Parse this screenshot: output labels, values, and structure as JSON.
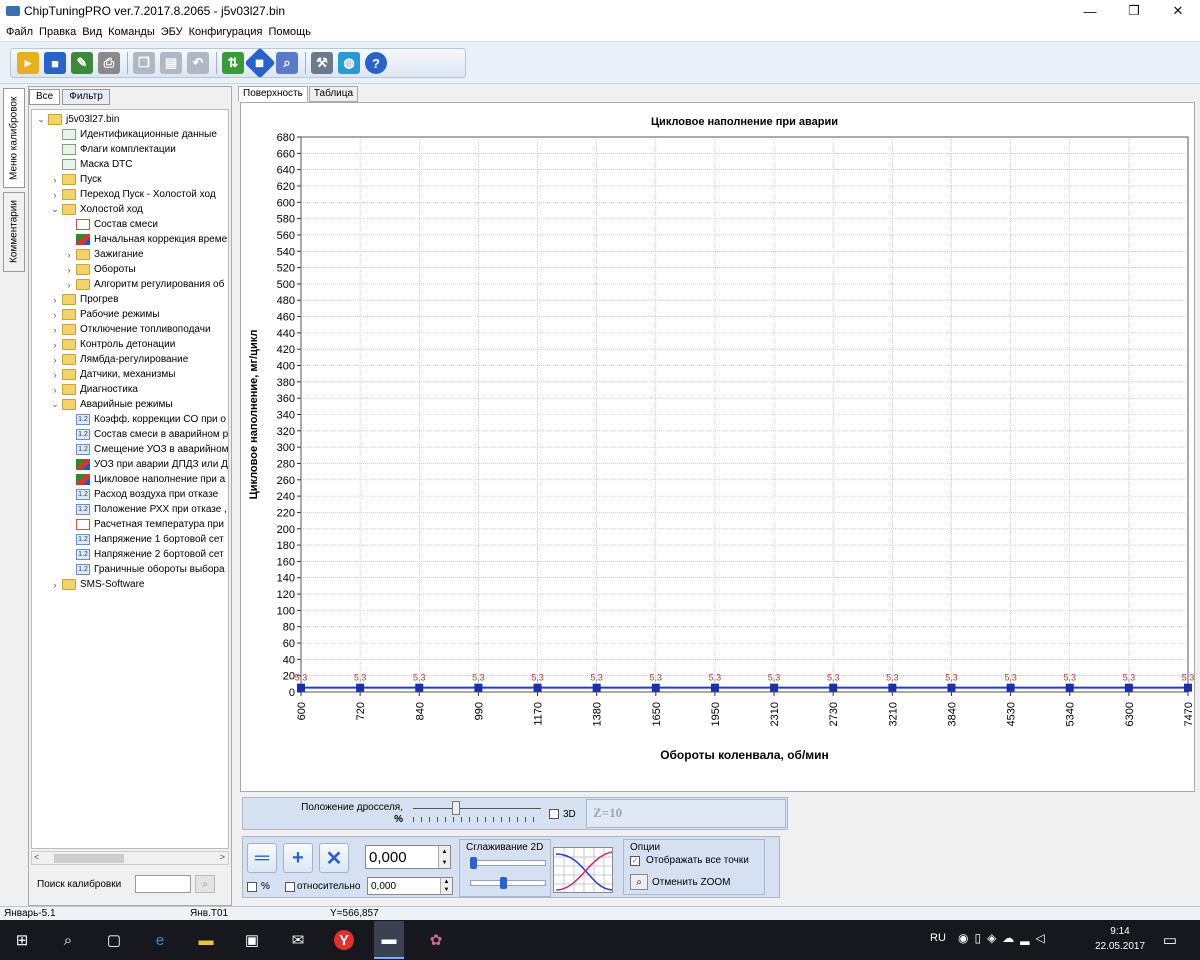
{
  "window": {
    "title": "ChipTuningPRO ver.7.2017.8.2065 - j5v03l27.bin"
  },
  "menu": [
    "Файл",
    "Правка",
    "Вид",
    "Команды",
    "ЭБУ",
    "Конфигурация",
    "Помощь"
  ],
  "side_tabs": {
    "calibration_menu": "Меню калибровок",
    "comments": "Комментарии"
  },
  "tree_tabs": {
    "all": "Все",
    "filter": "Фильтр"
  },
  "tree": [
    {
      "depth": 0,
      "icon": "folder",
      "expanded": true,
      "label": "j5v03l27.bin"
    },
    {
      "depth": 1,
      "icon": "check",
      "label": "Идентификационные данные"
    },
    {
      "depth": 1,
      "icon": "check",
      "label": "Флаги комплектации"
    },
    {
      "depth": 1,
      "icon": "check",
      "label": "Маска DTC"
    },
    {
      "depth": 1,
      "icon": "folder",
      "expanded": false,
      "label": "Пуск"
    },
    {
      "depth": 1,
      "icon": "folder",
      "expanded": false,
      "label": "Переход Пуск - Холостой ход"
    },
    {
      "depth": 1,
      "icon": "folder",
      "expanded": true,
      "label": "Холостой ход"
    },
    {
      "depth": 2,
      "icon": "graph",
      "label": "Состав смеси"
    },
    {
      "depth": 2,
      "icon": "chart3d",
      "label": "Начальная коррекция време"
    },
    {
      "depth": 2,
      "icon": "folder",
      "expanded": false,
      "label": "Зажигание"
    },
    {
      "depth": 2,
      "icon": "folder",
      "expanded": false,
      "label": "Обороты"
    },
    {
      "depth": 2,
      "icon": "folder",
      "expanded": false,
      "label": "Алгоритм регулирования об"
    },
    {
      "depth": 1,
      "icon": "folder",
      "expanded": false,
      "label": "Прогрев"
    },
    {
      "depth": 1,
      "icon": "folder",
      "expanded": false,
      "label": "Рабочие режимы"
    },
    {
      "depth": 1,
      "icon": "folder",
      "expanded": false,
      "label": "Отключение топливоподачи"
    },
    {
      "depth": 1,
      "icon": "folder",
      "expanded": false,
      "label": "Контроль детонации"
    },
    {
      "depth": 1,
      "icon": "folder",
      "expanded": false,
      "label": "Лямбда-регулирование"
    },
    {
      "depth": 1,
      "icon": "folder",
      "expanded": false,
      "label": "Датчики, механизмы"
    },
    {
      "depth": 1,
      "icon": "folder",
      "expanded": false,
      "label": "Диагностика"
    },
    {
      "depth": 1,
      "icon": "folder",
      "expanded": true,
      "label": "Аварийные режимы"
    },
    {
      "depth": 2,
      "icon": "n12",
      "label": "Коэфф. коррекции CO при о"
    },
    {
      "depth": 2,
      "icon": "n12",
      "label": "Состав смеси в аварийном р"
    },
    {
      "depth": 2,
      "icon": "n12",
      "label": "Смещение УОЗ в аварийном"
    },
    {
      "depth": 2,
      "icon": "chart3d",
      "label": "УОЗ при аварии ДПДЗ или Д"
    },
    {
      "depth": 2,
      "icon": "chart3d",
      "label": "Цикловое наполнение при а"
    },
    {
      "depth": 2,
      "icon": "n12",
      "label": "Расход воздуха при отказе"
    },
    {
      "depth": 2,
      "icon": "n12",
      "label": "Положение РХХ при отказе ,"
    },
    {
      "depth": 2,
      "icon": "graph",
      "label": "Расчетная температура при"
    },
    {
      "depth": 2,
      "icon": "n12",
      "label": "Напряжение 1 бортовой сет"
    },
    {
      "depth": 2,
      "icon": "n12",
      "label": "Напряжение 2 бортовой сет"
    },
    {
      "depth": 2,
      "icon": "n12",
      "label": "Граничные обороты выбора"
    },
    {
      "depth": 1,
      "icon": "folder",
      "expanded": false,
      "label": "SMS-Software"
    }
  ],
  "n12_glyph": "1.2",
  "search": {
    "label": "Поиск калибровки",
    "value": ""
  },
  "view_tabs": {
    "surface": "Поверхность",
    "table": "Таблица"
  },
  "chart_data": {
    "type": "line",
    "title": "Цикловое наполнение при аварии",
    "xlabel": "Обороты коленвала, об/мин",
    "ylabel": "Цикловое наполнение, мг/цикл",
    "ylim": [
      0,
      680
    ],
    "ytick_step": 20,
    "categories": [
      "600",
      "720",
      "840",
      "990",
      "1170",
      "1380",
      "1650",
      "1950",
      "2310",
      "2730",
      "3210",
      "3840",
      "4530",
      "5340",
      "6300",
      "7470"
    ],
    "point_label": "5,3",
    "series": [
      {
        "values": [
          5.3,
          5.3,
          5.3,
          5.3,
          5.3,
          5.3,
          5.3,
          5.3,
          5.3,
          5.3,
          5.3,
          5.3,
          5.3,
          5.3,
          5.3,
          5.3
        ]
      }
    ],
    "grid": true,
    "colors": {
      "line": "#1f3bd0",
      "marker": "#1a2fa8",
      "label": "#c0392b"
    }
  },
  "throttle": {
    "label_line1": "Положение дросселя,",
    "label_line2": "%",
    "value_3d_label": "3D",
    "z_label": "Z=10"
  },
  "controls": {
    "value": "0,000",
    "relative_value": "0,000",
    "percent_label": "%",
    "relative_label": "относительно",
    "smoothing_label": "Сглаживание 2D",
    "options_title": "Опции",
    "show_all_points": "Отображать все точки",
    "cancel_zoom": "Отменить ZOOM"
  },
  "status": {
    "left": "Январь-5.1",
    "mid": "Янв.Т01",
    "coord": "Y=566,857"
  },
  "taskbar": {
    "lang": "RU",
    "time": "9:14",
    "date": "22.05.2017"
  }
}
